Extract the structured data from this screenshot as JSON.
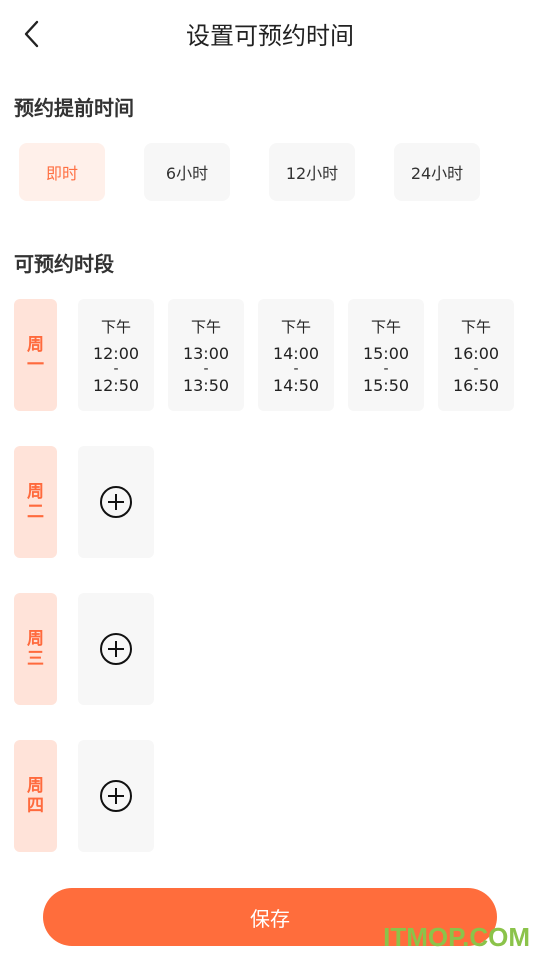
{
  "header": {
    "title": "设置可预约时间"
  },
  "advance": {
    "title": "预约提前时间",
    "options": [
      {
        "label": "即时",
        "selected": true
      },
      {
        "label": "6小时",
        "selected": false
      },
      {
        "label": "12小时",
        "selected": false
      },
      {
        "label": "24小时",
        "selected": false
      }
    ]
  },
  "period": {
    "title": "可预约时段",
    "days": [
      {
        "label": "周一",
        "slots": [
          {
            "period": "下午",
            "start": "12:00",
            "sep": "-",
            "end": "12:50"
          },
          {
            "period": "下午",
            "start": "13:00",
            "sep": "-",
            "end": "13:50"
          },
          {
            "period": "下午",
            "start": "14:00",
            "sep": "-",
            "end": "14:50"
          },
          {
            "period": "下午",
            "start": "15:00",
            "sep": "-",
            "end": "15:50"
          },
          {
            "period": "下午",
            "start": "16:00",
            "sep": "-",
            "end": "16:50"
          }
        ]
      },
      {
        "label": "周二",
        "slots": []
      },
      {
        "label": "周三",
        "slots": []
      },
      {
        "label": "周四",
        "slots": []
      }
    ]
  },
  "footer": {
    "save_label": "保存"
  },
  "watermark": "ITMOP.COM",
  "colors": {
    "accent": "#ff6d3c",
    "accent_light": "#ffe3d9",
    "selected_bg": "#fff0ea",
    "tile_bg": "#f7f7f7",
    "watermark": "#8bc34a"
  }
}
